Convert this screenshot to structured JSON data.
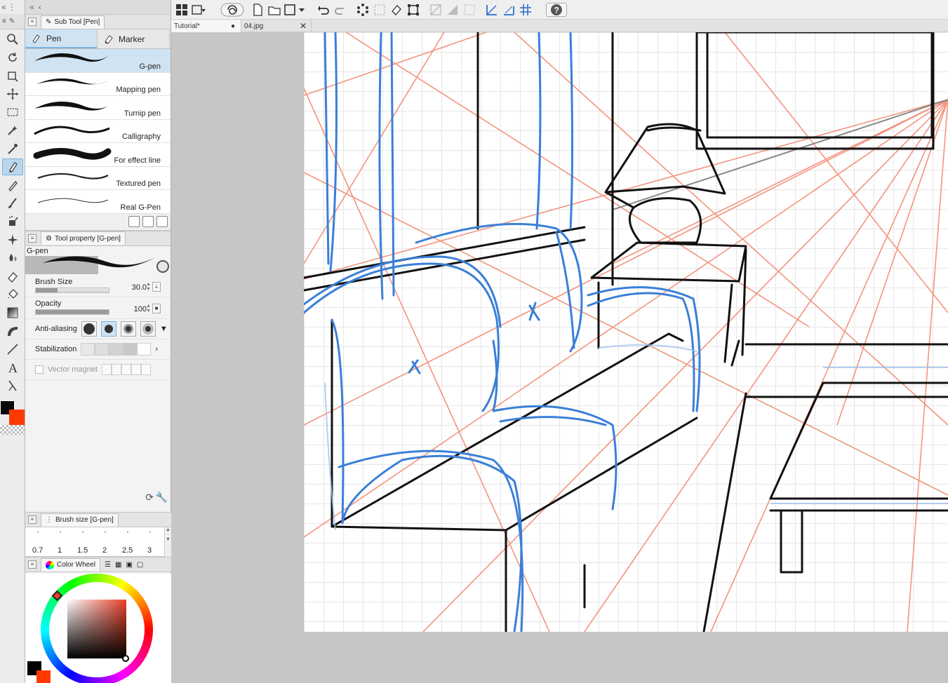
{
  "subtool_panel": {
    "title": "Sub Tool [Pen]",
    "groups": [
      {
        "label": "Pen",
        "icon": "pen-icon"
      },
      {
        "label": "Marker",
        "icon": "marker-icon"
      }
    ],
    "brushes": [
      {
        "label": "G-pen"
      },
      {
        "label": "Mapping pen"
      },
      {
        "label": "Turnip pen"
      },
      {
        "label": "Calligraphy"
      },
      {
        "label": "For effect line"
      },
      {
        "label": "Textured pen"
      },
      {
        "label": "Real G-Pen"
      }
    ]
  },
  "tool_property": {
    "title": "Tool property [G-pen]",
    "preview_label": "G-pen",
    "brush_size_label": "Brush Size",
    "brush_size_value": "30.0",
    "brush_size_fill": 0.3,
    "opacity_label": "Opacity",
    "opacity_value": "100",
    "opacity_fill": 1.0,
    "anti_aliasing_label": "Anti-aliasing",
    "stabilization_label": "Stabilization",
    "vector_magnet_label": "Vector magnet"
  },
  "brush_size_panel": {
    "title": "Brush size [G-pen]",
    "sizes": [
      "0.7",
      "1",
      "1.5",
      "2",
      "2.5",
      "3"
    ]
  },
  "color_panel": {
    "title": "Color Wheel",
    "main_color": "#000000",
    "sub_color": "#ff3a00",
    "hue_marker_color": "#e8402a"
  },
  "document_tabs": [
    {
      "label": "Tutorial*"
    },
    {
      "label": "04.jpg"
    }
  ],
  "colors": {
    "accent": "#7fb2dc",
    "sketch_blue": "#3a7fd8",
    "perspective_red": "#f2896f",
    "ink": "#111111"
  }
}
